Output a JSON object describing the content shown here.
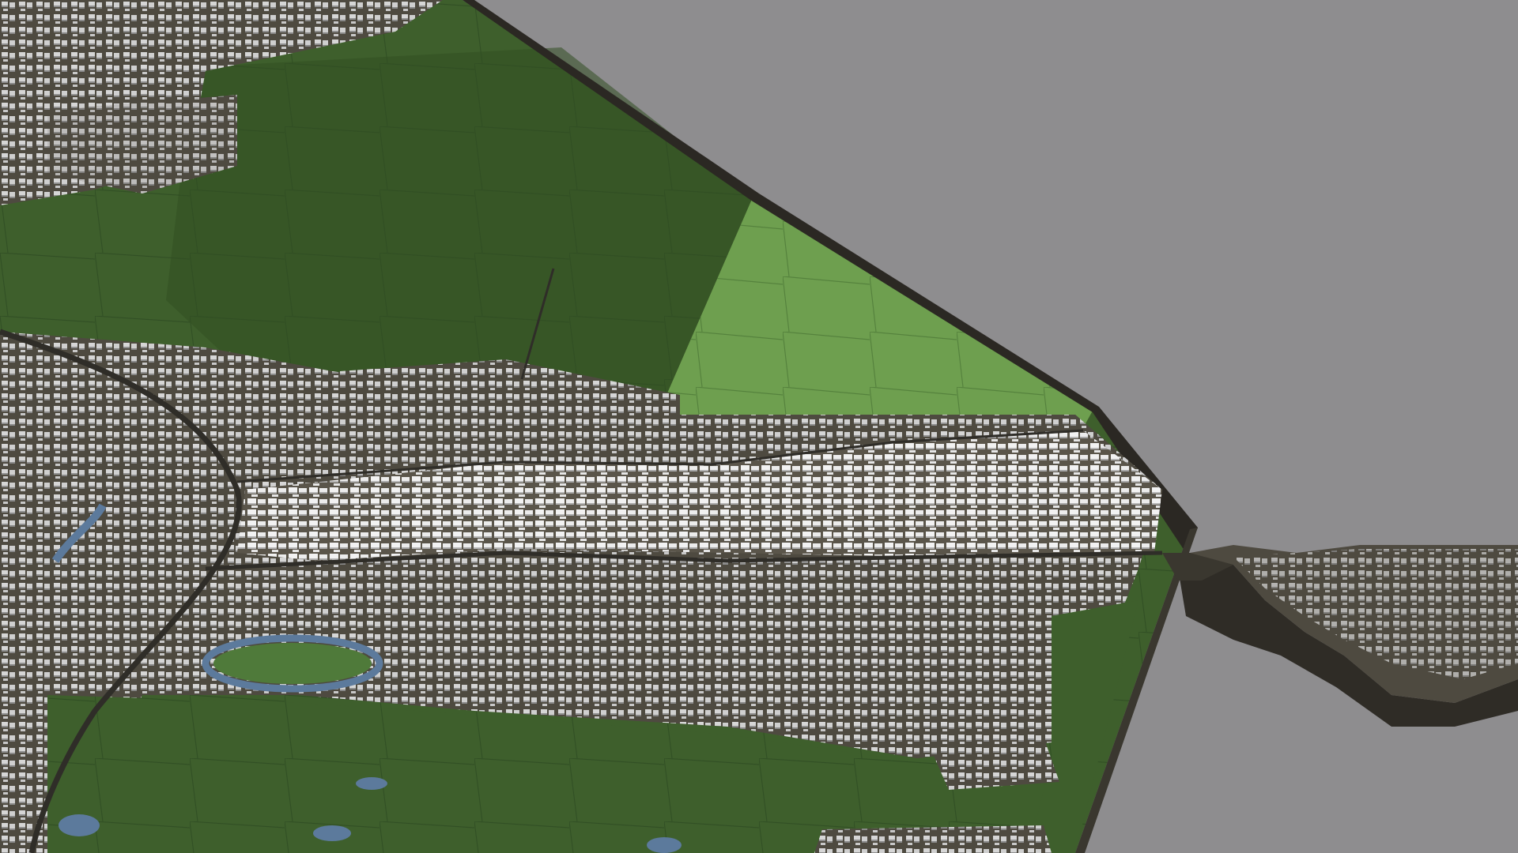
{
  "scene": {
    "description_visible_text": "",
    "colors": {
      "background": "#8e8d8f",
      "forest": "#3e5f2c",
      "forest_dark": "#314f22",
      "meadow": "#6e9f4f",
      "meadow_light": "#79aa58",
      "urban_ground": "#4e4a40",
      "urban_ground_light": "#6b6458",
      "plinth_side": "#3a372f",
      "plinth_edge": "#2b2823",
      "buildings": "#d8d8d8",
      "buildings_shadow": "#a9a9a9",
      "roads": "#2f2d28",
      "water": "#5c7a9c",
      "park_green": "#4f7a3a"
    },
    "regions": [
      {
        "name": "city-block",
        "kind": "urban"
      },
      {
        "name": "northern-forest",
        "kind": "forest"
      },
      {
        "name": "bright-meadow",
        "kind": "meadow"
      },
      {
        "name": "southern-forest",
        "kind": "forest"
      },
      {
        "name": "eastern-peninsula",
        "kind": "urban"
      },
      {
        "name": "river-loop",
        "kind": "water"
      }
    ]
  }
}
